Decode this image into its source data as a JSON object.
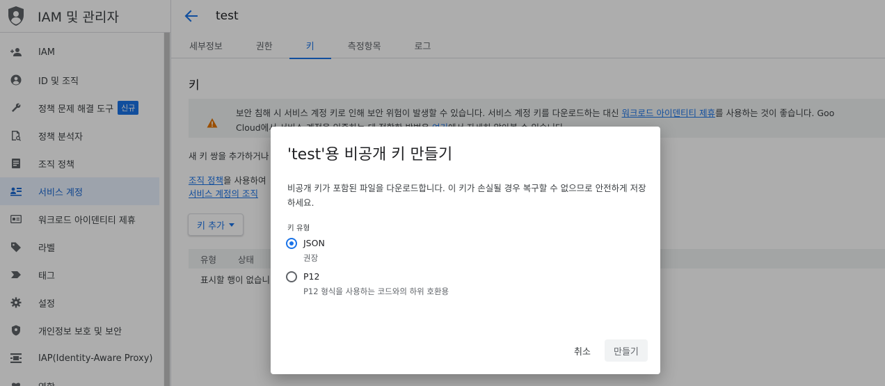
{
  "app": {
    "title": "IAM 및 관리자"
  },
  "sidebar": {
    "items": [
      {
        "label": "IAM",
        "icon": "person-add-icon"
      },
      {
        "label": "ID 및 조직",
        "icon": "account-circle-icon"
      },
      {
        "label": "정책 문제 해결 도구",
        "icon": "wrench-icon",
        "badge": "신규"
      },
      {
        "label": "정책 분석자",
        "icon": "policy-analyzer-icon"
      },
      {
        "label": "조직 정책",
        "icon": "document-icon"
      },
      {
        "label": "서비스 계정",
        "icon": "service-account-icon",
        "active": true
      },
      {
        "label": "워크로드 아이덴티티 제휴",
        "icon": "id-card-icon"
      },
      {
        "label": "라벨",
        "icon": "label-icon"
      },
      {
        "label": "태그",
        "icon": "tag-icon"
      },
      {
        "label": "설정",
        "icon": "gear-icon"
      },
      {
        "label": "개인정보 보호 및 보안",
        "icon": "shield-icon"
      },
      {
        "label": "IAP(Identity-Aware Proxy)",
        "icon": "proxy-icon"
      },
      {
        "label": "역할",
        "icon": "role-icon"
      }
    ]
  },
  "header": {
    "page_title": "test"
  },
  "tabs": [
    {
      "label": "세부정보"
    },
    {
      "label": "권한"
    },
    {
      "label": "키",
      "active": true
    },
    {
      "label": "측정항목"
    },
    {
      "label": "로그"
    }
  ],
  "content": {
    "section_title": "키",
    "warning": {
      "line1_a": "보안 침해 시 서비스 계정 키로 인해 보안 위험이 발생할 수 있습니다. 서비스 계정 키를 다운로드하는 대신 ",
      "line1_link": "워크로드 아이덴티티 제휴",
      "line1_b": "를 사용하는 것이 좋습니다. Goo",
      "line2_a": "Cloud에서 서비스 계정을 인증하는 데 적합한 방법은 ",
      "line2_link": "여기",
      "line2_b": "에서 자세히 알아볼 수 있습니다."
    },
    "desc": "새 키 쌍을 추가하거나",
    "policy_link1": "조직 정책",
    "policy_text": "을 사용하여",
    "policy_link2": "서비스 계정의 조직",
    "add_key_label": "키 추가",
    "table": {
      "headers": [
        "유형",
        "상태"
      ],
      "empty_text": "표시할 행이 없습니다"
    }
  },
  "dialog": {
    "title": "'test'용 비공개 키 만들기",
    "description": "비공개 키가 포함된 파일을 다운로드합니다. 이 키가 손실될 경우 복구할 수 없으므로 안전하게 저장하세요.",
    "key_type_label": "키 유형",
    "options": [
      {
        "label": "JSON",
        "sub": "권장",
        "checked": true
      },
      {
        "label": "P12",
        "sub": "P12 형식을 사용하는 코드와의 하위 호환용",
        "checked": false
      }
    ],
    "cancel_label": "취소",
    "create_label": "만들기"
  },
  "colors": {
    "accent": "#1a73e8",
    "warning": "#e37400"
  }
}
